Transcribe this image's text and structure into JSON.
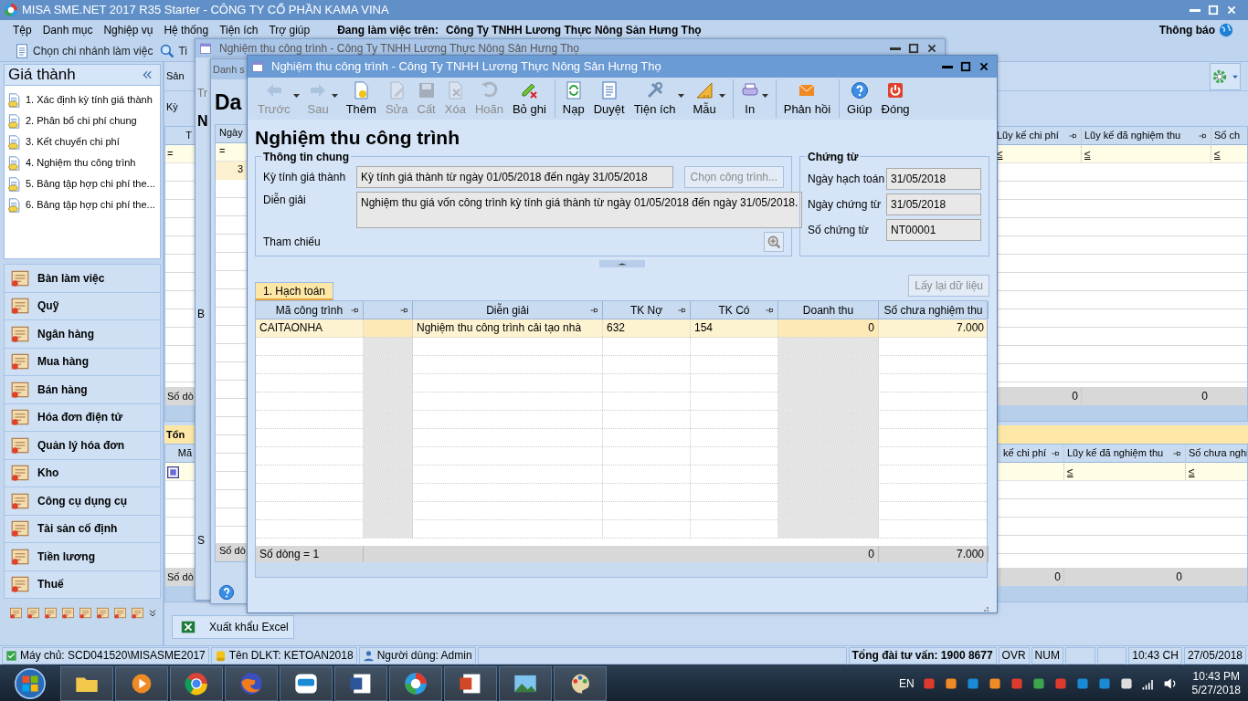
{
  "app": {
    "title": "MISA SME.NET 2017 R35 Starter - CÔNG TY CỔ PHẦN KAMA VINA"
  },
  "menu": [
    "Tệp",
    "Danh mục",
    "Nghiệp vụ",
    "Hệ thống",
    "Tiện ích",
    "Trợ giúp"
  ],
  "workspace": {
    "label": "Đang làm việc trên:",
    "company": "Công Ty TNHH Lương Thực Nông Sản Hưng Thọ"
  },
  "notifications": "Thông báo",
  "toolbar": [
    {
      "label": "Chọn chi nhánh làm việc",
      "kind": "branch"
    },
    {
      "label": "Ti",
      "kind": "search"
    }
  ],
  "sidebar": {
    "title": "Giá thành",
    "items": [
      "1. Xác định kỳ tính giá thành",
      "2. Phân bổ chi phí chung",
      "3. Kết chuyển chi phí",
      "4. Nghiệm thu công trình",
      "5. Bảng tập hợp chi phí the...",
      "6. Bảng tập hợp chi phí the..."
    ],
    "modules": [
      "Bàn làm việc",
      "Quỹ",
      "Ngân hàng",
      "Mua hàng",
      "Bán hàng",
      "Hóa đơn điện tử",
      "Quản lý hóa đơn",
      "Kho",
      "Công cụ dụng cụ",
      "Tài sản cố định",
      "Tiền lương",
      "Thuế"
    ]
  },
  "main": {
    "tab": "Sản",
    "period_label": "Kỳ",
    "upper_grid": {
      "left_header": "T",
      "left_filter": "=",
      "footer": "Số dò",
      "columns": [
        {
          "label": "Lũy kế chi phí",
          "pinned": true,
          "filter": "≤",
          "total": "0"
        },
        {
          "label": "Lũy kế đã nghiệm thu",
          "pinned": true,
          "filter": "≤",
          "total": "0"
        },
        {
          "label": "Số ch",
          "pinned": false,
          "filter": "≤"
        }
      ]
    },
    "lower_grid": {
      "tab": "Tổn",
      "left_header": "Mã",
      "footer": "Số dò",
      "columns": [
        {
          "label": "kế chi phí",
          "pinned": true,
          "total": "0"
        },
        {
          "label": "Lũy kế đã nghiệm thu",
          "pinned": true,
          "filter": "≤",
          "total": "0"
        },
        {
          "label": "Số chưa nghi",
          "pinned": false,
          "filter": "≤"
        }
      ]
    },
    "export_button": "Xuất khẩu Excel"
  },
  "background_windows": [
    {
      "title": "Nghiệm thu công trình - Công Ty TNHH Lương Thực Nông Sản Hưng Thọ",
      "fragments": [
        "Tr",
        "N",
        "B",
        "S"
      ]
    },
    {
      "title": "Danh s",
      "heading": "Da",
      "grid_header": "Ngày",
      "filter": "=",
      "row_value": "3",
      "footer": "Số dò"
    }
  ],
  "dialog": {
    "title": "Nghiệm thu công trình - Công Ty TNHH Lương Thực Nông Sản Hưng Thọ",
    "toolbar": [
      {
        "label": "Trước",
        "kind": "back",
        "disabled": true,
        "dropdown": true,
        "separator_before": false
      },
      {
        "label": "Sau",
        "kind": "forward",
        "disabled": true,
        "dropdown": true,
        "separator_before": false
      },
      {
        "label": "Thêm",
        "kind": "add",
        "disabled": false,
        "dropdown": false,
        "separator_before": false
      },
      {
        "label": "Sửa",
        "kind": "edit",
        "disabled": true,
        "dropdown": false,
        "separator_before": false
      },
      {
        "label": "Cất",
        "kind": "save",
        "disabled": true,
        "dropdown": false,
        "separator_before": false
      },
      {
        "label": "Xóa",
        "kind": "delete",
        "disabled": true,
        "dropdown": false,
        "separator_before": false
      },
      {
        "label": "Hoãn",
        "kind": "undo",
        "disabled": true,
        "dropdown": false,
        "separator_before": false
      },
      {
        "label": "Bỏ ghi",
        "kind": "unpost",
        "disabled": false,
        "dropdown": false,
        "separator_before": false
      },
      {
        "label": "Nạp",
        "kind": "reload",
        "disabled": false,
        "dropdown": false,
        "separator_before": true
      },
      {
        "label": "Duyệt",
        "kind": "browse",
        "disabled": false,
        "dropdown": false,
        "separator_before": false
      },
      {
        "label": "Tiện ích",
        "kind": "tools",
        "disabled": false,
        "dropdown": true,
        "separator_before": false
      },
      {
        "label": "Mẫu",
        "kind": "template",
        "disabled": false,
        "dropdown": true,
        "separator_before": false
      },
      {
        "label": "In",
        "kind": "print",
        "disabled": false,
        "dropdown": true,
        "separator_before": true
      },
      {
        "label": "Phản hồi",
        "kind": "feedback",
        "disabled": false,
        "dropdown": false,
        "separator_before": true
      },
      {
        "label": "Giúp",
        "kind": "help",
        "disabled": false,
        "dropdown": false,
        "separator_before": true
      },
      {
        "label": "Đóng",
        "kind": "close",
        "disabled": false,
        "dropdown": false,
        "separator_before": false
      }
    ],
    "heading": "Nghiệm thu công trình",
    "general": {
      "title": "Thông tin chung",
      "period_label": "Kỳ tính giá thành",
      "period": "Kỳ tính giá thành từ ngày 01/05/2018 đến ngày 31/05/2018",
      "choose_button": {
        "label": "Chọn công trình...",
        "disabled": true
      },
      "description_label": "Diễn giải",
      "description": "Nghiệm thu giá vốn công trình kỳ tính giá thành từ ngày 01/05/2018 đến ngày 31/05/2018.",
      "reference_label": "Tham chiếu"
    },
    "voucher": {
      "title": "Chứng từ",
      "fields": [
        {
          "label": "Ngày hạch toán",
          "value": "31/05/2018"
        },
        {
          "label": "Ngày chứng từ",
          "value": "31/05/2018"
        },
        {
          "label": "Số chứng từ",
          "value": "NT00001"
        }
      ]
    },
    "tabs": [
      {
        "label": "1. Hạch toán",
        "selected": true
      }
    ],
    "reload_button": {
      "label": "Lấy lại dữ liệu",
      "disabled": true
    },
    "grid": {
      "columns": [
        {
          "label": "Mã công trình",
          "pinned": true,
          "readonly": false
        },
        {
          "pinned": true,
          "readonly": true
        },
        {
          "label": "Diễn giải",
          "pinned": true,
          "readonly": false
        },
        {
          "label": "TK Nợ",
          "pinned": true,
          "readonly": false
        },
        {
          "label": "TK Có",
          "pinned": true,
          "readonly": false
        },
        {
          "label": "Doanh thu",
          "pinned": false,
          "readonly": true,
          "total": "0"
        },
        {
          "label": "Số chưa nghiệm thu",
          "pinned": false,
          "readonly": false,
          "total": "7.000"
        }
      ],
      "rows": [
        {
          "selected": true,
          "cells": [
            "CAITAONHA",
            "",
            "Nghiệm thu công trình cải tạo nhà",
            "632",
            "154",
            "0",
            "7.000"
          ]
        }
      ],
      "row_count": "Số dòng = 1"
    }
  },
  "status_bar": [
    {
      "kind": "server",
      "text": "Máy chủ: SCD041520\\MISASME2017"
    },
    {
      "kind": "database",
      "text": "Tên DLKT: KETOAN2018"
    },
    {
      "kind": "user",
      "text": "Người dùng: Admin"
    },
    {
      "kind": "blank"
    },
    {
      "kind": "hotline",
      "text": "Tổng đài tư vấn: 1900 8677"
    },
    {
      "kind": "plain",
      "text": "OVR"
    },
    {
      "kind": "plain",
      "text": "NUM"
    },
    {
      "kind": "blank"
    },
    {
      "kind": "blank"
    },
    {
      "kind": "plain",
      "text": "10:43 CH"
    },
    {
      "kind": "plain",
      "text": "27/05/2018"
    }
  ],
  "taskbar": {
    "apps": [
      {
        "kind": "folder"
      },
      {
        "kind": "media"
      },
      {
        "kind": "browser"
      },
      {
        "kind": "fox"
      },
      {
        "kind": "chat"
      },
      {
        "kind": "word"
      },
      {
        "kind": "pinwheel"
      },
      {
        "kind": "slides"
      },
      {
        "kind": "photos"
      },
      {
        "kind": "paint"
      }
    ],
    "language": "EN",
    "time": "10:43 PM",
    "date": "5/27/2018"
  }
}
